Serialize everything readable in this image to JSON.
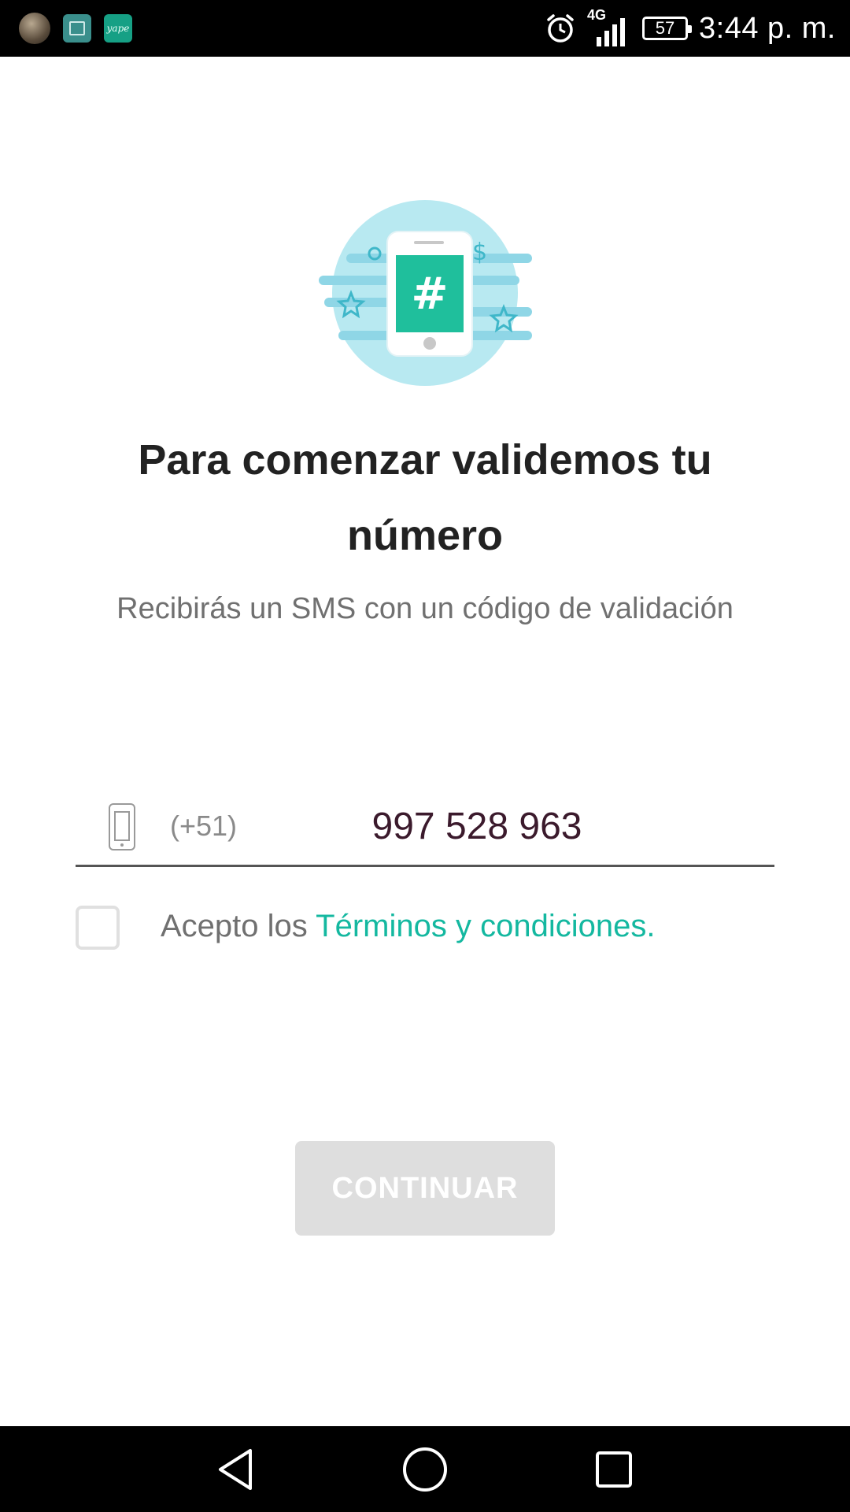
{
  "status_bar": {
    "time": "3:44 p. m.",
    "battery": "57",
    "network": "4G",
    "yape_badge": "yape",
    "icons": [
      "avatar-icon",
      "gallery-icon",
      "yape-app-icon",
      "alarm-icon",
      "signal-icon",
      "battery-icon"
    ]
  },
  "illustration": {
    "icon": "phone-hash-illustration",
    "accent": "#1fbf9c",
    "circle_color": "#b8e9f1"
  },
  "title": "Para comenzar validemos tu número",
  "subtitle": "Recibirás un SMS con un código de validación",
  "phone": {
    "icon": "smartphone-icon",
    "prefix": "(+51)",
    "value": "997 528 963"
  },
  "terms": {
    "prefix_text": "Acepto los ",
    "link_text": "Términos y condiciones.",
    "checked": false
  },
  "continue_button": {
    "label": "CONTINUAR",
    "enabled": false
  },
  "navigation": {
    "back": "back-icon",
    "home": "home-icon",
    "recents": "recents-icon"
  },
  "colors": {
    "accent": "#14b8a0",
    "button_disabled": "#dedede",
    "title": "#222222"
  }
}
